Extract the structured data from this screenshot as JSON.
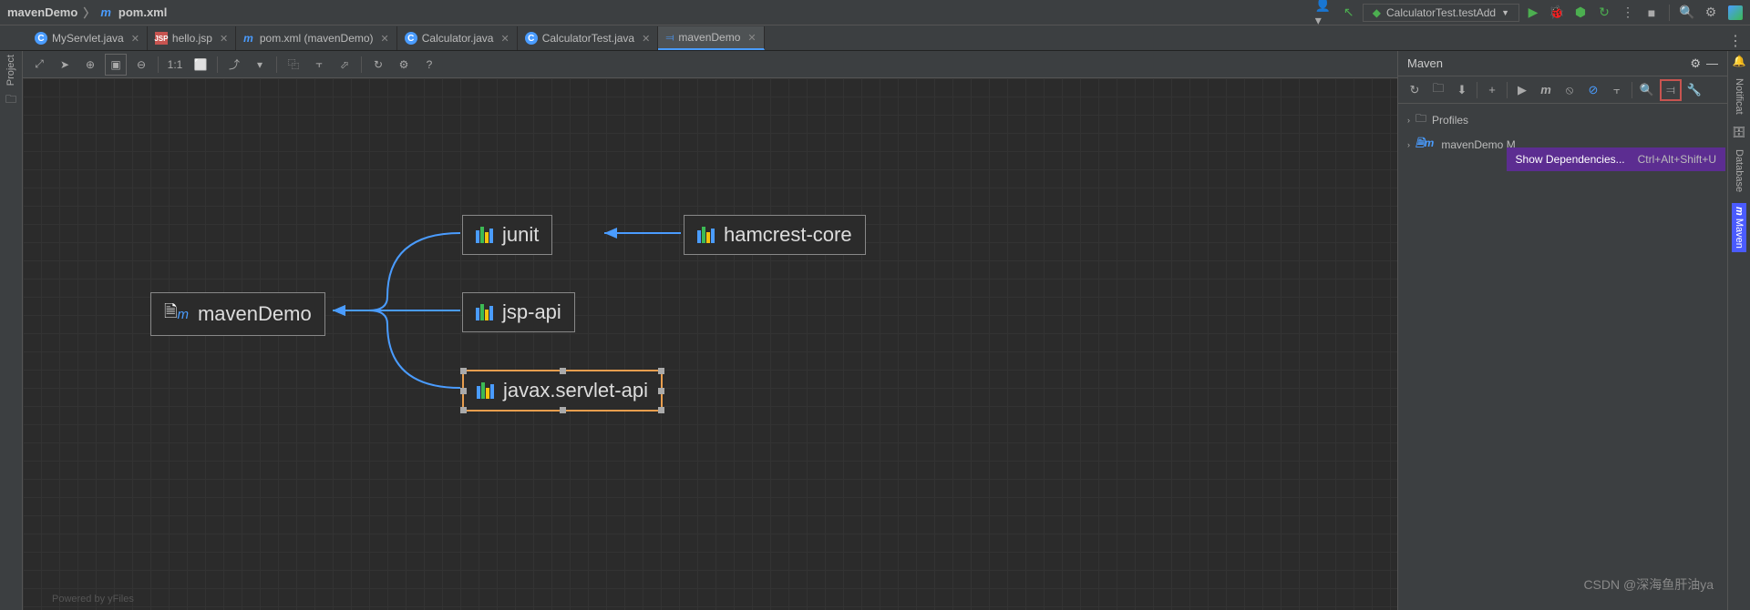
{
  "breadcrumb": {
    "project": "mavenDemo",
    "file": "pom.xml"
  },
  "run_config": "CalculatorTest.testAdd",
  "tabs": [
    {
      "label": "MyServlet.java",
      "type": "class"
    },
    {
      "label": "hello.jsp",
      "type": "jsp"
    },
    {
      "label": "pom.xml (mavenDemo)",
      "type": "maven"
    },
    {
      "label": "Calculator.java",
      "type": "class"
    },
    {
      "label": "CalculatorTest.java",
      "type": "class"
    },
    {
      "label": "mavenDemo",
      "type": "diagram"
    }
  ],
  "nodes": {
    "root": "mavenDemo",
    "junit": "junit",
    "jsp": "jsp-api",
    "servlet": "javax.servlet-api",
    "hamcrest": "hamcrest-core"
  },
  "maven_panel": {
    "title": "Maven",
    "profiles": "Profiles",
    "project": "mavenDemo M"
  },
  "tooltip": {
    "text": "Show Dependencies...",
    "shortcut": "Ctrl+Alt+Shift+U"
  },
  "right_tabs": {
    "notif": "Notificat",
    "db": "Database",
    "maven": "Maven"
  },
  "left_tab": "Project",
  "footer": "Powered by yFiles",
  "watermark": "CSDN @深海鱼肝油ya"
}
